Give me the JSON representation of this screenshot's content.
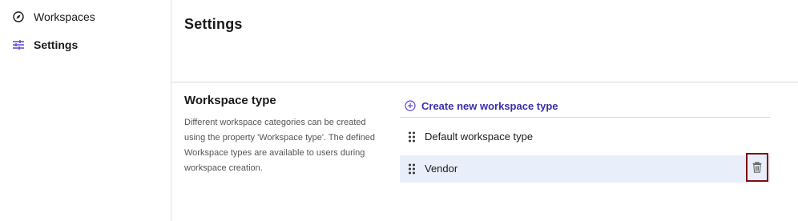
{
  "sidebar": {
    "items": [
      {
        "label": "Workspaces",
        "icon": "compass-icon",
        "active": false
      },
      {
        "label": "Settings",
        "icon": "sliders-icon",
        "active": true
      }
    ]
  },
  "main": {
    "title": "Settings",
    "section": {
      "title": "Workspace type",
      "description": "Different workspace categories can be created using the property 'Workspace type'. The defined Workspace types are available to users during workspace creation."
    },
    "create_label": "Create new workspace type",
    "types": [
      {
        "label": "Default workspace type",
        "selected": false
      },
      {
        "label": "Vendor",
        "selected": true
      }
    ]
  },
  "colors": {
    "accent": "#3a2ea8",
    "selected_row": "#e9effa",
    "delete_highlight": "#7a0f12",
    "divider": "#d9d9d9"
  }
}
